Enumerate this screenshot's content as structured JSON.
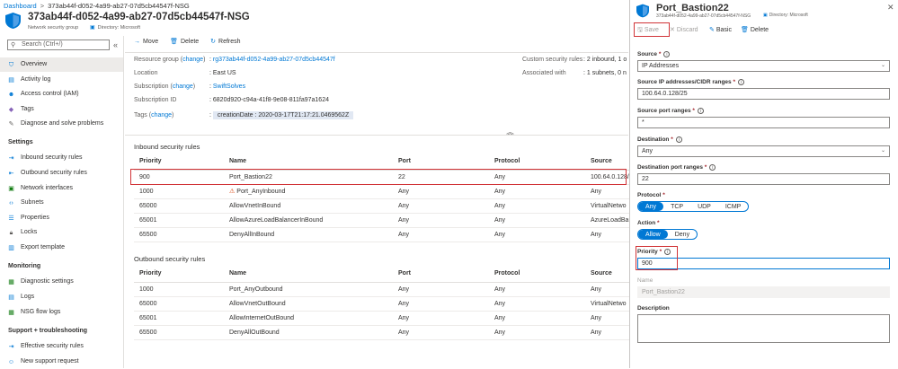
{
  "breadcrumb": {
    "root": "Dashboard",
    "separator": ">",
    "current": "373ab44f-d052-4a99-ab27-07d5cb44547f-NSG"
  },
  "header": {
    "title": "373ab44f-d052-4a99-ab27-07d5cb44547f-NSG",
    "subtitle": "Network security group",
    "directory": "Directory: Microsoft"
  },
  "sidebar": {
    "search_placeholder": "Search (Ctrl+/)",
    "collapse": "«",
    "items_top": [
      {
        "label": "Overview",
        "icon": "shield-icon"
      },
      {
        "label": "Activity log",
        "icon": "activity-log-icon"
      },
      {
        "label": "Access control (IAM)",
        "icon": "people-icon"
      },
      {
        "label": "Tags",
        "icon": "tag-icon"
      },
      {
        "label": "Diagnose and solve problems",
        "icon": "wrench-icon"
      }
    ],
    "section_settings": "Settings",
    "items_settings": [
      {
        "label": "Inbound security rules",
        "icon": "inbound-icon"
      },
      {
        "label": "Outbound security rules",
        "icon": "outbound-icon"
      },
      {
        "label": "Network interfaces",
        "icon": "network-icon"
      },
      {
        "label": "Subnets",
        "icon": "subnet-icon"
      },
      {
        "label": "Properties",
        "icon": "properties-icon"
      },
      {
        "label": "Locks",
        "icon": "lock-icon"
      },
      {
        "label": "Export template",
        "icon": "export-icon"
      }
    ],
    "section_monitoring": "Monitoring",
    "items_monitoring": [
      {
        "label": "Diagnostic settings",
        "icon": "diagnostic-icon"
      },
      {
        "label": "Logs",
        "icon": "logs-icon"
      },
      {
        "label": "NSG flow logs",
        "icon": "flow-logs-icon"
      }
    ],
    "section_support": "Support + troubleshooting",
    "items_support": [
      {
        "label": "Effective security rules",
        "icon": "effective-rules-icon"
      },
      {
        "label": "New support request",
        "icon": "support-icon"
      }
    ]
  },
  "toolbar": {
    "move": "Move",
    "delete": "Delete",
    "refresh": "Refresh"
  },
  "essentials": {
    "resource_group_label": "Resource group",
    "change": "change",
    "resource_group": "rg373ab44f-d052-4a99-ab27-07d5cb44547f",
    "location_label": "Location",
    "location": "East US",
    "subscription_label": "Subscription",
    "subscription": "SwiftSolves",
    "subscription_id_label": "Subscription ID",
    "subscription_id": "6820d920-c94a-41f8-9e08-811fa97a1624",
    "tags_label": "Tags",
    "tag": "creationDate : 2020-03-17T21:17:21.0469562Z",
    "custom_rules_label": "Custom security rules",
    "custom_rules": ": 2 inbound, 1 o",
    "associated_label": "Associated with",
    "associated": ": 1 subnets, 0 n"
  },
  "inbound": {
    "title": "Inbound security rules",
    "headers": [
      "Priority",
      "Name",
      "Port",
      "Protocol",
      "Source"
    ],
    "rows": [
      [
        "900",
        "Port_Bastion22",
        "22",
        "Any",
        "100.64.0.128/"
      ],
      [
        "1000",
        "Port_AnyInbound",
        "Any",
        "Any",
        "Any"
      ],
      [
        "65000",
        "AllowVnetInBound",
        "Any",
        "Any",
        "VirtualNetwo"
      ],
      [
        "65001",
        "AllowAzureLoadBalancerInBound",
        "Any",
        "Any",
        "AzureLoadBa"
      ],
      [
        "65500",
        "DenyAllInBound",
        "Any",
        "Any",
        "Any"
      ]
    ]
  },
  "outbound": {
    "title": "Outbound security rules",
    "headers": [
      "Priority",
      "Name",
      "Port",
      "Protocol",
      "Source"
    ],
    "rows": [
      [
        "1000",
        "Port_AnyOutbound",
        "Any",
        "Any",
        "Any"
      ],
      [
        "65000",
        "AllowVnetOutBound",
        "Any",
        "Any",
        "VirtualNetwo"
      ],
      [
        "65001",
        "AllowInternetOutBound",
        "Any",
        "Any",
        "Any"
      ],
      [
        "65500",
        "DenyAllOutBound",
        "Any",
        "Any",
        "Any"
      ]
    ]
  },
  "panel": {
    "title": "Port_Bastion22",
    "subtitle": "373ab44f-d052-4a99-ab27-07d5cb44547f-NSG",
    "directory": "Directory: Microsoft",
    "close": "✕",
    "save": "Save",
    "discard": "Discard",
    "basic": "Basic",
    "delete": "Delete",
    "source_label": "Source",
    "source_value": "IP Addresses",
    "source_ip_label": "Source IP addresses/CIDR ranges",
    "source_ip_value": "100.64.0.128/25",
    "source_port_label": "Source port ranges",
    "source_port_value": "*",
    "destination_label": "Destination",
    "destination_value": "Any",
    "dest_port_label": "Destination port ranges",
    "dest_port_value": "22",
    "protocol_label": "Protocol",
    "protocol_options": [
      "Any",
      "TCP",
      "UDP",
      "ICMP"
    ],
    "action_label": "Action",
    "action_options": [
      "Allow",
      "Deny"
    ],
    "priority_label": "Priority",
    "priority_value": "900",
    "name_label": "Name",
    "name_value": "Port_Bastion22",
    "description_label": "Description",
    "required": "*",
    "info": "i"
  },
  "colors": {
    "accent": "#0078d4",
    "highlight": "#d13438",
    "warning": "#d83b01"
  }
}
